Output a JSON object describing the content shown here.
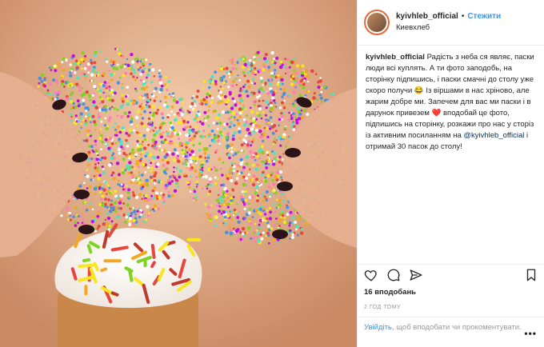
{
  "post": {
    "username": "kyivhleb_official",
    "separator": "•",
    "follow_label": "Стежити",
    "location": "Киевхлеб",
    "caption_user": "kyivhleb_official",
    "caption_text_1": "Радість з неба ся являє, паски люди всі куплять. А ти фото заподобь, на сторінку підпишись, і паски смачні до столу уже скоро получи ",
    "emoji_1": "😂",
    "caption_text_2": " Із віршами в нас хріново, але жарим добре ми. Запечем для вас ми паски і в дарунок привезем ",
    "emoji_2": "❤️",
    "caption_text_3": " вподобай це фото, підпишись на сторінку, розкажи про нас у сторіз із активним посиланням на ",
    "mention": "@kyivhleb_official",
    "caption_text_4": " і отримай 30 пасок до столу!",
    "likes": "16 вподобань",
    "time_ago": "2 ГОД ТОМУ",
    "login_link": "Увійдіть",
    "comment_prompt": ", щоб вподобати чи прокоментувати.",
    "more_label": "•••"
  },
  "icons": {
    "like": "heart-icon",
    "comment": "comment-icon",
    "share": "share-icon",
    "save": "bookmark-icon"
  },
  "colors": {
    "follow": "#3897f0",
    "text": "#262626",
    "muted": "#999999",
    "border": "#efefef"
  }
}
